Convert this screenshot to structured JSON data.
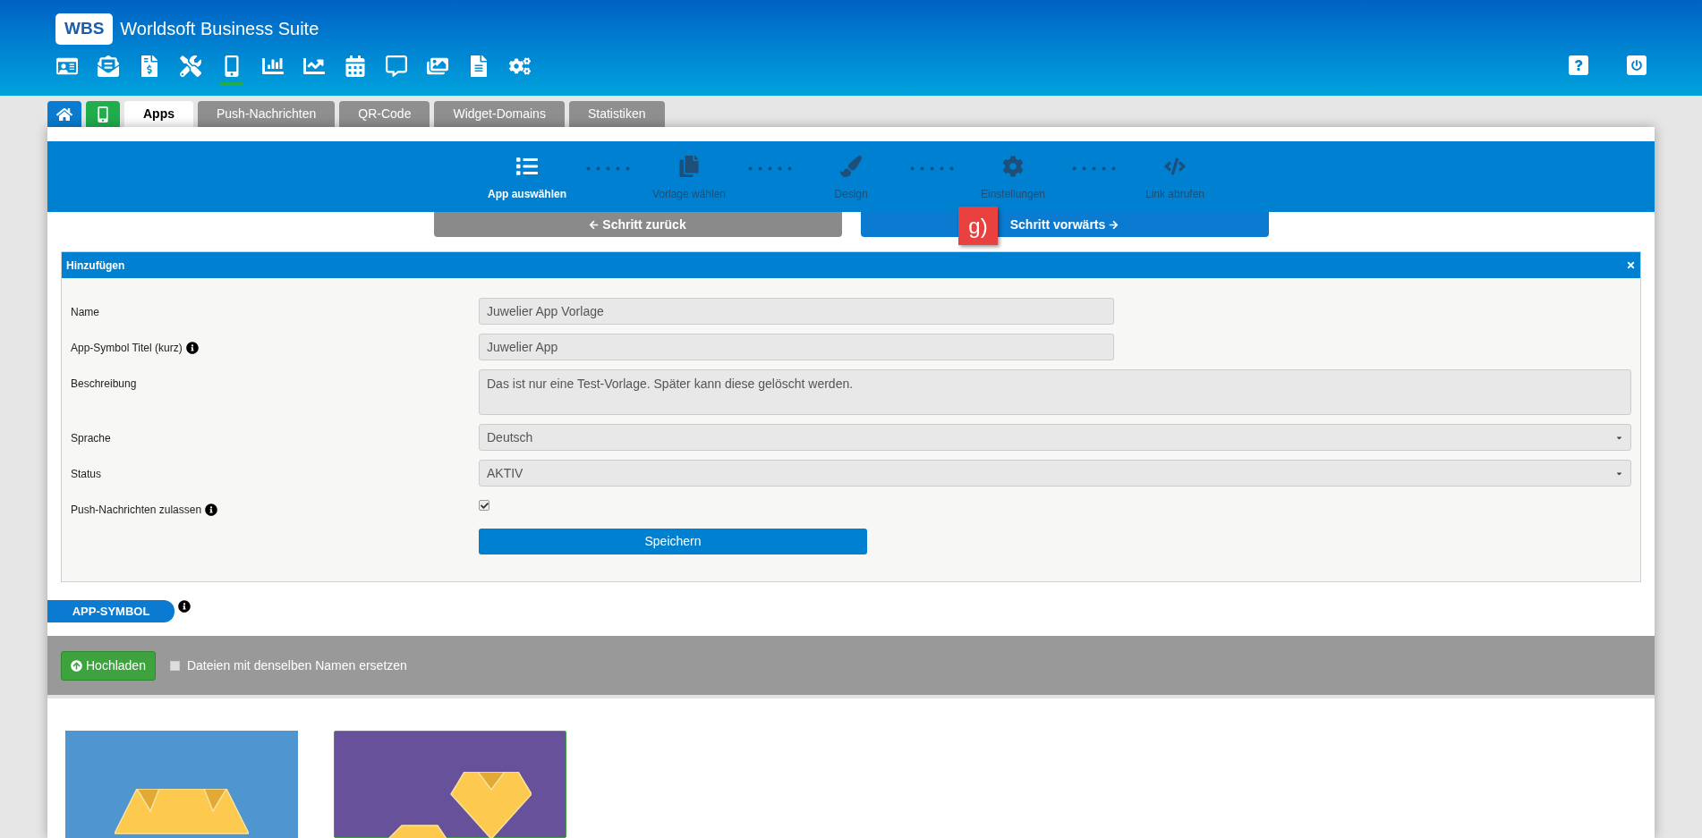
{
  "header": {
    "logo_badge": "WBS",
    "title": "Worldsoft Business Suite",
    "nav_icons": [
      {
        "selected": false
      },
      {
        "selected": false
      },
      {
        "selected": false
      },
      {
        "selected": false
      },
      {
        "selected": true
      },
      {
        "selected": false
      },
      {
        "selected": false
      },
      {
        "selected": false
      },
      {
        "selected": false
      },
      {
        "selected": false
      },
      {
        "selected": false
      },
      {
        "selected": false
      }
    ]
  },
  "icon_tabs": [
    {
      "kind": "home",
      "selected": false
    },
    {
      "kind": "mobile",
      "selected": false
    }
  ],
  "tabs": [
    {
      "label": "Apps",
      "selected": true
    },
    {
      "label": "Push-Nachrichten",
      "selected": false
    },
    {
      "label": "QR-Code",
      "selected": false
    },
    {
      "label": "Widget-Domains",
      "selected": false
    },
    {
      "label": "Statistiken",
      "selected": false
    }
  ],
  "steps": [
    {
      "label": "App auswählen",
      "kind": "list",
      "selected": true
    },
    {
      "label": "Vorlage wählen",
      "kind": "template",
      "selected": false
    },
    {
      "label": "Design",
      "kind": "brush",
      "selected": false
    },
    {
      "label": "Einstellungen",
      "kind": "gear",
      "selected": false
    },
    {
      "label": "Link abrufen",
      "kind": "code",
      "selected": false
    }
  ],
  "nav_buttons": {
    "back": "Schritt zurück",
    "forward": "Schritt vorwärts",
    "annotation": "g)"
  },
  "form": {
    "title": "Hinzufügen",
    "fields": [
      {
        "kind": "text",
        "label": "Name",
        "info": false,
        "value": "Juwelier App Vorlage"
      },
      {
        "kind": "text",
        "label": "App-Symbol Titel (kurz)",
        "info": true,
        "value": "Juwelier App"
      },
      {
        "kind": "textarea",
        "label": "Beschreibung",
        "info": false,
        "value": "Das ist nur eine Test-Vorlage. Später kann diese gelöscht werden."
      },
      {
        "kind": "select",
        "label": "Sprache",
        "info": false,
        "value": "Deutsch"
      },
      {
        "kind": "select",
        "label": "Status",
        "info": false,
        "value": "AKTIV"
      },
      {
        "kind": "checkbox",
        "label": "Push-Nachrichten zulassen",
        "info": true,
        "checked": true
      }
    ],
    "submit": "Speichern"
  },
  "app_symbol": {
    "title": "APP-SYMBOL",
    "upload_button": "Hochladen",
    "replace_checkbox": {
      "label": "Dateien mit denselben Namen ersetzen",
      "checked": false
    },
    "images": [
      {
        "color": "#4f96d0",
        "selected": false
      },
      {
        "color": "#67519a",
        "selected": true
      }
    ]
  }
}
